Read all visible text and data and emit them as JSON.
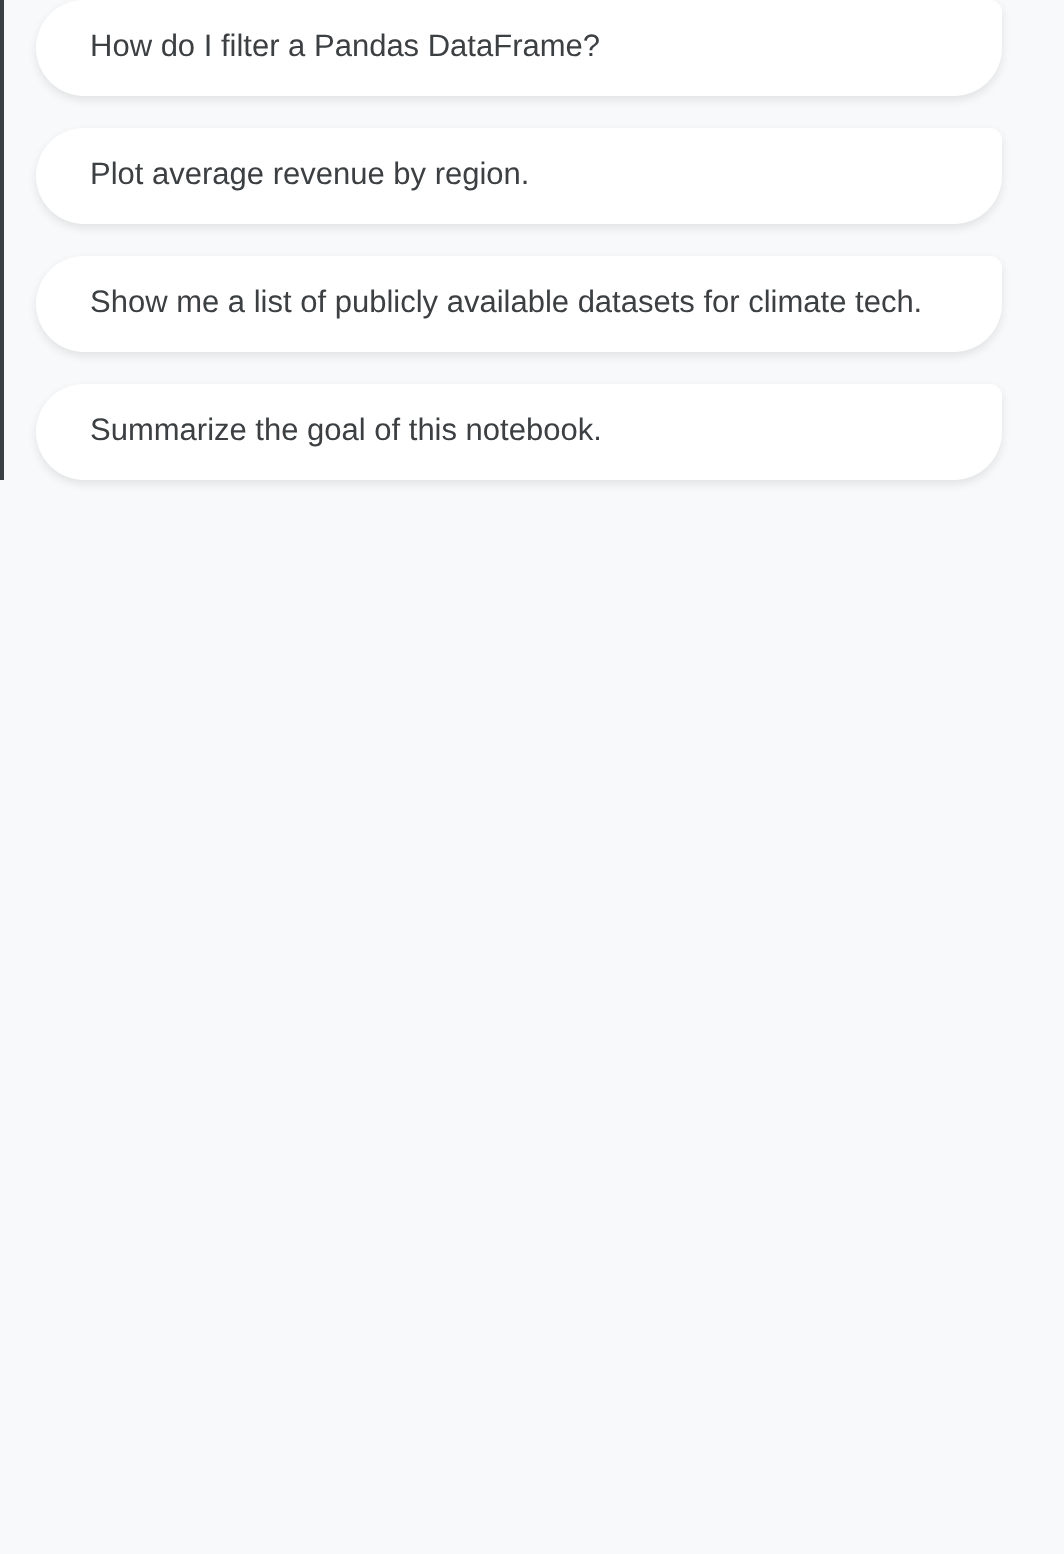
{
  "suggestions": [
    {
      "label": "How do I filter a Pandas DataFrame?"
    },
    {
      "label": "Plot average revenue by region."
    },
    {
      "label": "Show me a list of publicly available datasets for climate tech."
    },
    {
      "label": "Summarize the goal of this notebook."
    }
  ]
}
